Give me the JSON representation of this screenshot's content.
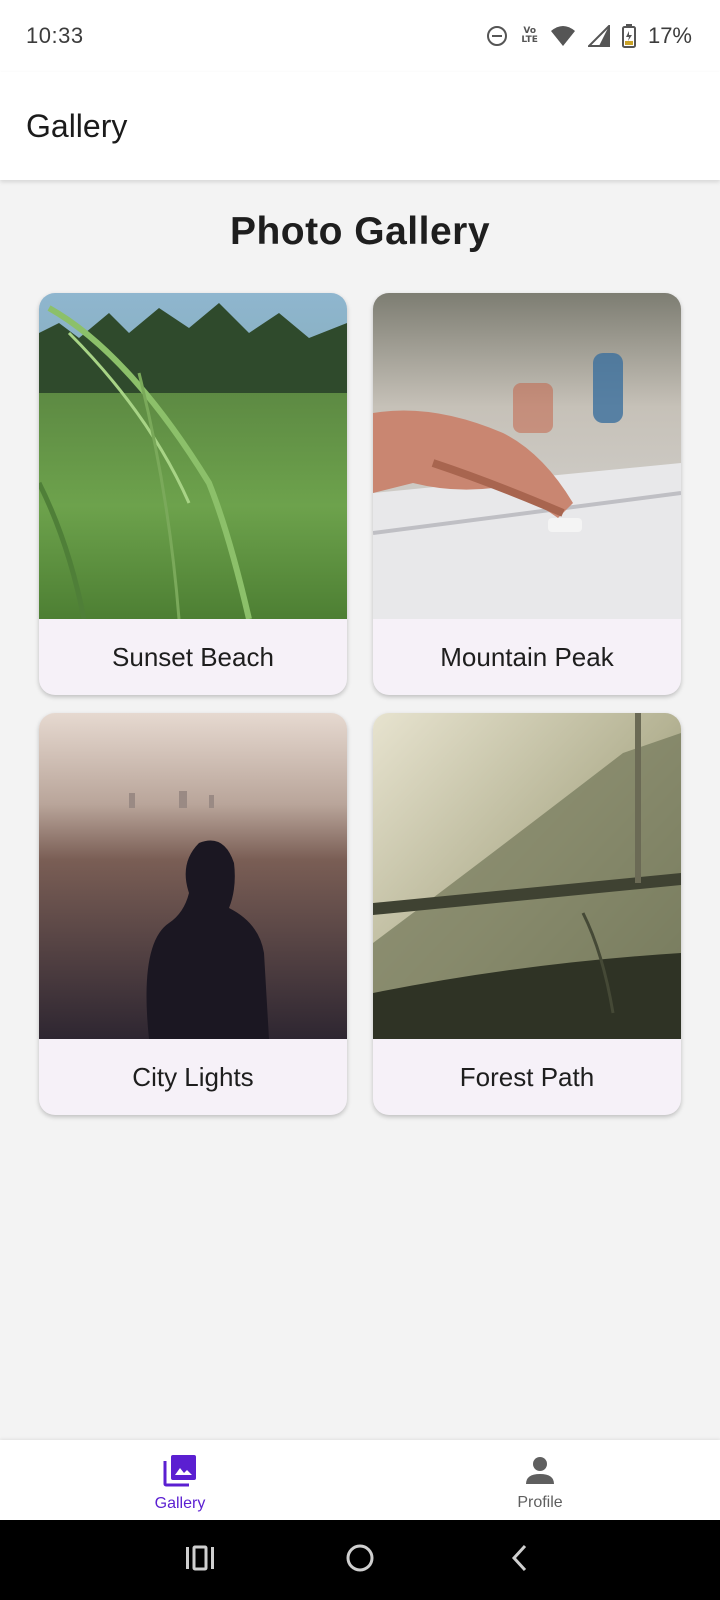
{
  "status_bar": {
    "time": "10:33",
    "battery_percent": "17%",
    "network_label_top": "Vo",
    "network_label_bottom": "LTE",
    "icons": [
      "do-not-disturb-icon",
      "volte-icon",
      "wifi-icon",
      "signal-icon",
      "battery-charging-icon"
    ]
  },
  "app_bar": {
    "title": "Gallery"
  },
  "main": {
    "title": "Photo Gallery",
    "photos": [
      {
        "caption": "Sunset Beach",
        "image": "grass-closeup-photo"
      },
      {
        "caption": "Mountain Peak",
        "image": "hand-on-mixer-photo"
      },
      {
        "caption": "City Lights",
        "image": "woman-overlooking-city-photo"
      },
      {
        "caption": "Forest Path",
        "image": "misty-hillside-photo"
      }
    ]
  },
  "bottom_nav": {
    "items": [
      {
        "label": "Gallery",
        "icon": "photo-library-icon",
        "active": true
      },
      {
        "label": "Profile",
        "icon": "person-icon",
        "active": false
      }
    ]
  },
  "system_nav": {
    "buttons": [
      "recents-icon",
      "home-icon",
      "back-icon"
    ]
  },
  "colors": {
    "accent": "#5b1fd1",
    "card_background": "#f6f1f8",
    "page_background": "#f3f3f3"
  }
}
